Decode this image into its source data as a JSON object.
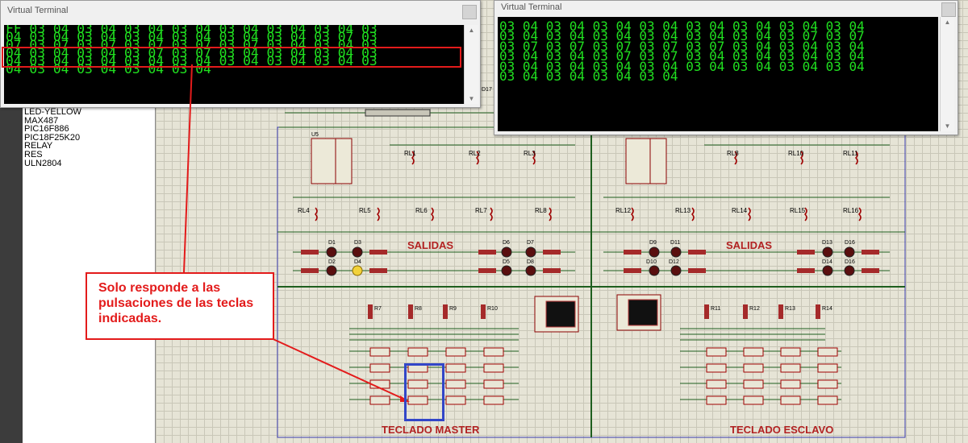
{
  "terminal_left": {
    "title": "Virtual Terminal",
    "lines": [
      "FF 03 04 03 04 03 04 03 04 03 04 03 04 03 04 03",
      "04 03 04 03 04 03 04 03 04 03 04 03 04 03 07 03",
      "07 03 07 03 07 03 07 03 07 03 07 03 04 03 04 03",
      "04 03 04 03 04 03 07 03 07 03 04 03 04 03 04 03",
      "04 03 04 03 04 03 04 03 04 03 04 03 04 03 04 03",
      "04 03 04 03 04 03 04 03 04"
    ]
  },
  "terminal_right": {
    "title": "Virtual Terminal",
    "lines": [
      "03 04 03 04 03 04 03 04 03 04 03 04 03 04 03 04",
      "03 04 03 04 03 04 03 04 03 04 03 04 03 07 03 07",
      "03 07 03 07 03 07 03 07 03 07 03 04 03 04 03 04",
      "03 04 03 04 03 07 03 07 03 04 03 04 03 04 03 04",
      "03 04 03 04 03 04 03 04 03 04 03 04 03 04 03 04",
      "03 04 03 04 03 04 03 04"
    ]
  },
  "component_list": [
    "LED-YELLOW",
    "MAX487",
    "PIC16F886",
    "PIC18F25K20",
    "RELAY",
    "RES",
    "ULN2804"
  ],
  "schematic": {
    "salidas_left": "SALIDAS",
    "salidas_right": "SALIDAS",
    "teclado_master": "TECLADO MASTER",
    "teclado_esclavo": "TECLADO ESCLAVO",
    "relays": [
      "RL1",
      "RL2",
      "RL3",
      "RL8",
      "RL10",
      "RL11",
      "RL4",
      "RL5",
      "RL6",
      "RL7",
      "RL8",
      "RL12",
      "RL13",
      "RL14",
      "RL15",
      "RL16"
    ],
    "resistors": [
      "R7",
      "R8",
      "R9",
      "R10",
      "R11",
      "R12",
      "R13",
      "R14"
    ],
    "leds": [
      "D1",
      "D3",
      "D2",
      "D4",
      "D6",
      "D7",
      "D5",
      "D8",
      "D9",
      "D11",
      "D10",
      "D12",
      "D13",
      "D16",
      "D14",
      "D16"
    ],
    "chip_label": "U5",
    "d17_label": "D17"
  },
  "annotation": "Solo responde a las pulsaciones de las teclas indicadas.",
  "colors": {
    "terminal_text": "#20e020",
    "annotation_red": "#e31b1b",
    "highlight_blue": "#3246c8"
  }
}
